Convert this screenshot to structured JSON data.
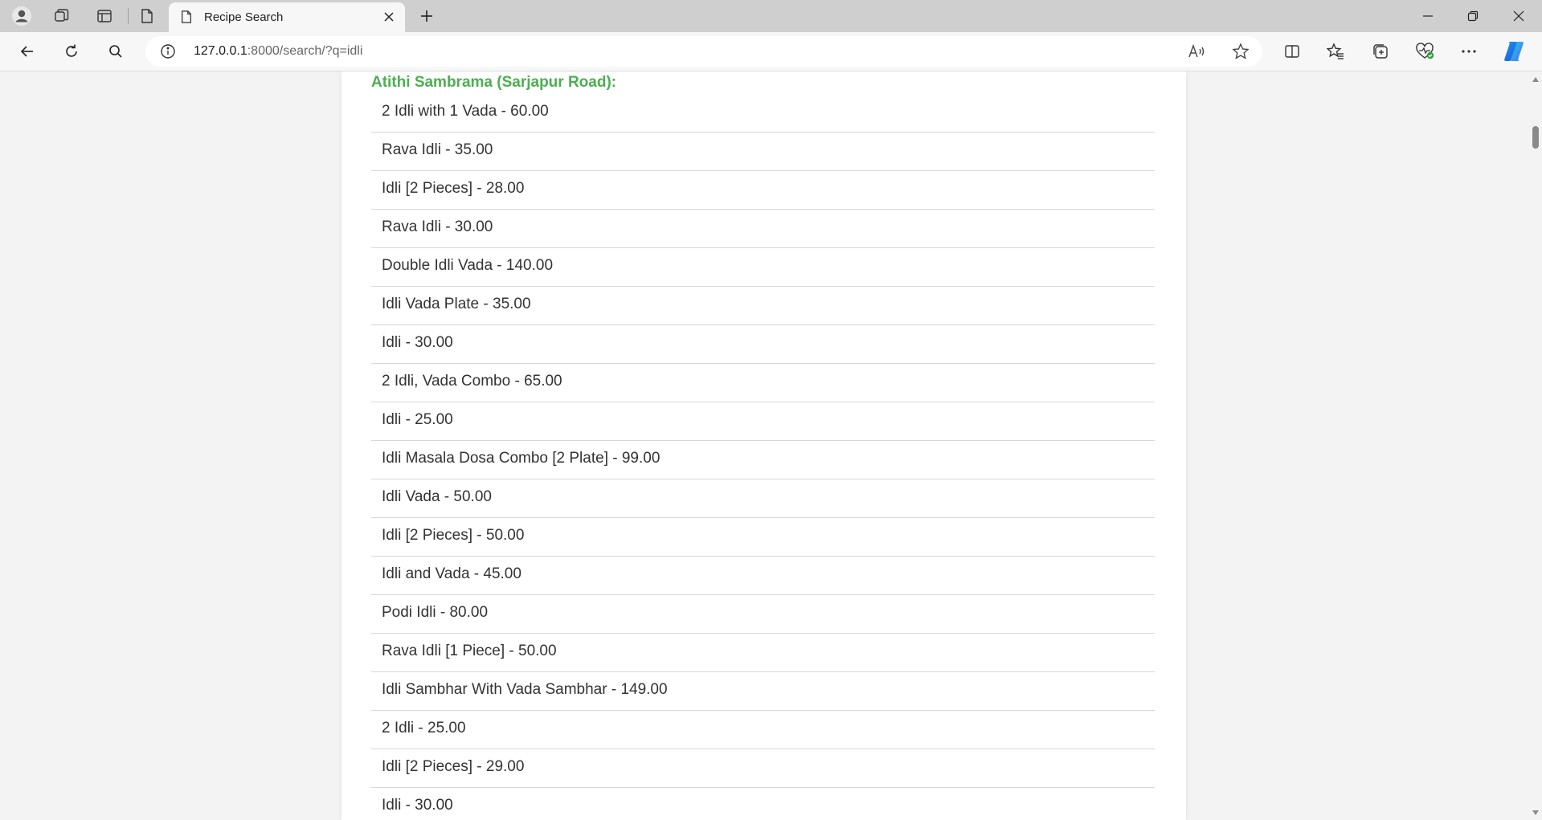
{
  "browser": {
    "tab": {
      "title": "Recipe Search"
    },
    "address": {
      "host": "127.0.0.1",
      "rest": ":8000/search/?q=idli"
    },
    "icons": {
      "profile": "profile-icon",
      "workspaces": "workspaces-icon",
      "tab_actions": "tab-actions-icon",
      "page": "page-icon",
      "close_tab": "close-icon",
      "new_tab": "plus-icon",
      "back": "back-arrow-icon",
      "refresh": "refresh-icon",
      "search": "search-icon",
      "info": "info-icon",
      "read_aloud": "read-aloud-icon",
      "favorite": "star-icon",
      "split_screen": "split-screen-icon",
      "favorites": "favorites-icon",
      "collections": "collections-icon",
      "browser_essentials": "heart-pulse-icon",
      "more": "more-icon",
      "copilot": "copilot-icon"
    }
  },
  "results": {
    "restaurant": "Atithi Sambrama (Sarjapur Road):",
    "items": [
      "2 Idli with 1 Vada - 60.00",
      "Rava Idli - 35.00",
      "Idli [2 Pieces] - 28.00",
      "Rava Idli - 30.00",
      "Double Idli Vada - 140.00",
      "Idli Vada Plate - 35.00",
      "Idli - 30.00",
      "2 Idli, Vada Combo - 65.00",
      "Idli - 25.00",
      "Idli Masala Dosa Combo [2 Plate] - 99.00",
      "Idli Vada - 50.00",
      "Idli [2 Pieces] - 50.00",
      "Idli and Vada - 45.00",
      "Podi Idli - 80.00",
      "Rava Idli [1 Piece] - 50.00",
      "Idli Sambhar With Vada Sambhar - 149.00",
      "2 Idli - 25.00",
      "Idli [2 Pieces] - 29.00",
      "Idli - 30.00"
    ]
  },
  "colors": {
    "accent_green": "#4caf50",
    "tabstrip": "#cfcfcf",
    "page_bg": "#f3f3f3"
  }
}
